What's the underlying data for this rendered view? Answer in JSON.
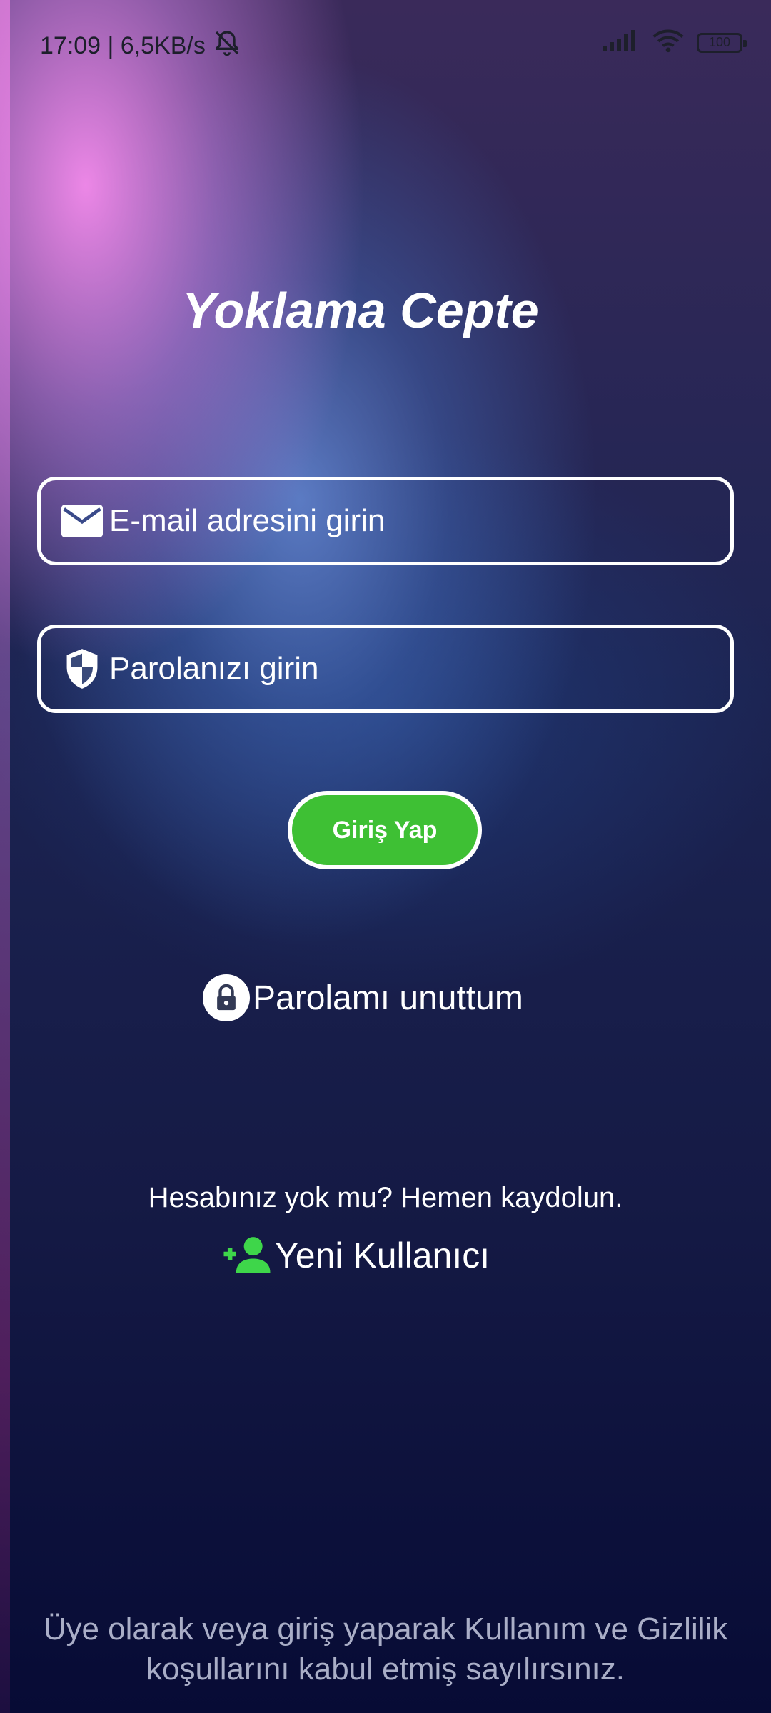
{
  "status_bar": {
    "time_speed": "17:09 | 6,5KB/s",
    "battery": "100",
    "icons": [
      "bell-off-icon",
      "signal-icon",
      "wifi-icon",
      "battery-icon"
    ]
  },
  "app": {
    "title": "Yoklama Cepte"
  },
  "email_field": {
    "placeholder": "E-mail adresini girin",
    "value": "",
    "icon": "mail-icon"
  },
  "password_field": {
    "placeholder": "Parolanızı girin",
    "value": "",
    "icon": "shield-icon"
  },
  "login_button": {
    "label": "Giriş Yap",
    "color": "#3ec034"
  },
  "forgot_password": {
    "label": "Parolamı unuttum",
    "icon": "lock-icon"
  },
  "signup": {
    "prompt": "Hesabınız yok mu? Hemen kaydolun.",
    "label": "Yeni Kullanıcı",
    "icon": "add-user-icon",
    "icon_color": "#3ed64a"
  },
  "terms": {
    "line1": "Üye olarak veya giriş yaparak Kullanım ve Gizlilik",
    "line2": "koşullarını kabul etmiş sayılırsınız."
  }
}
